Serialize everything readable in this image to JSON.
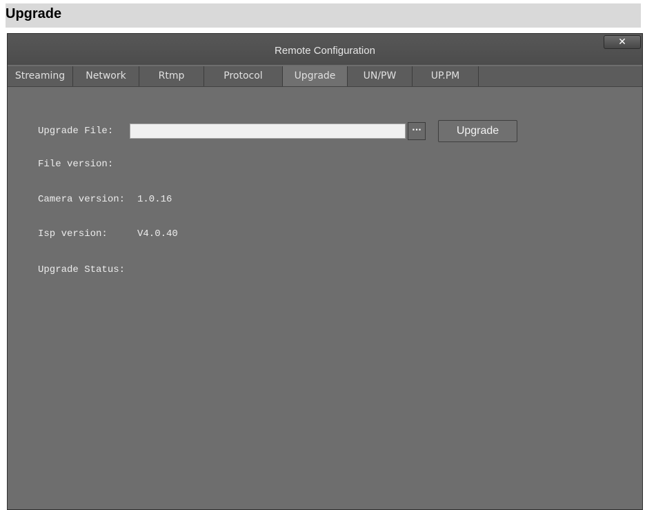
{
  "page": {
    "heading": "Upgrade"
  },
  "window": {
    "title": "Remote Configuration",
    "close_glyph": "✕"
  },
  "tabs": [
    {
      "label": "Streaming",
      "active": false
    },
    {
      "label": "Network",
      "active": false
    },
    {
      "label": "Rtmp",
      "active": false
    },
    {
      "label": "Protocol",
      "active": false
    },
    {
      "label": "Upgrade",
      "active": true
    },
    {
      "label": "UN/PW",
      "active": false
    },
    {
      "label": "UP.PM",
      "active": false
    }
  ],
  "upgrade_panel": {
    "file_label": "Upgrade File:",
    "file_value": "",
    "browse_label": "···",
    "upgrade_button": "Upgrade",
    "file_version_label": "File version:",
    "file_version_value": "",
    "camera_version_label": "Camera version:",
    "camera_version_value": "1.0.16",
    "isp_version_label": "Isp version:",
    "isp_version_value": "V4.0.40",
    "status_label": "Upgrade Status:",
    "status_value": ""
  },
  "colors": {
    "window_bg": "#6e6e6e",
    "titlebar_bg": "#505050",
    "tabbar_bg": "#5c5c5c",
    "active_tab_bg": "#707070",
    "header_bg": "#d9d9d9"
  }
}
